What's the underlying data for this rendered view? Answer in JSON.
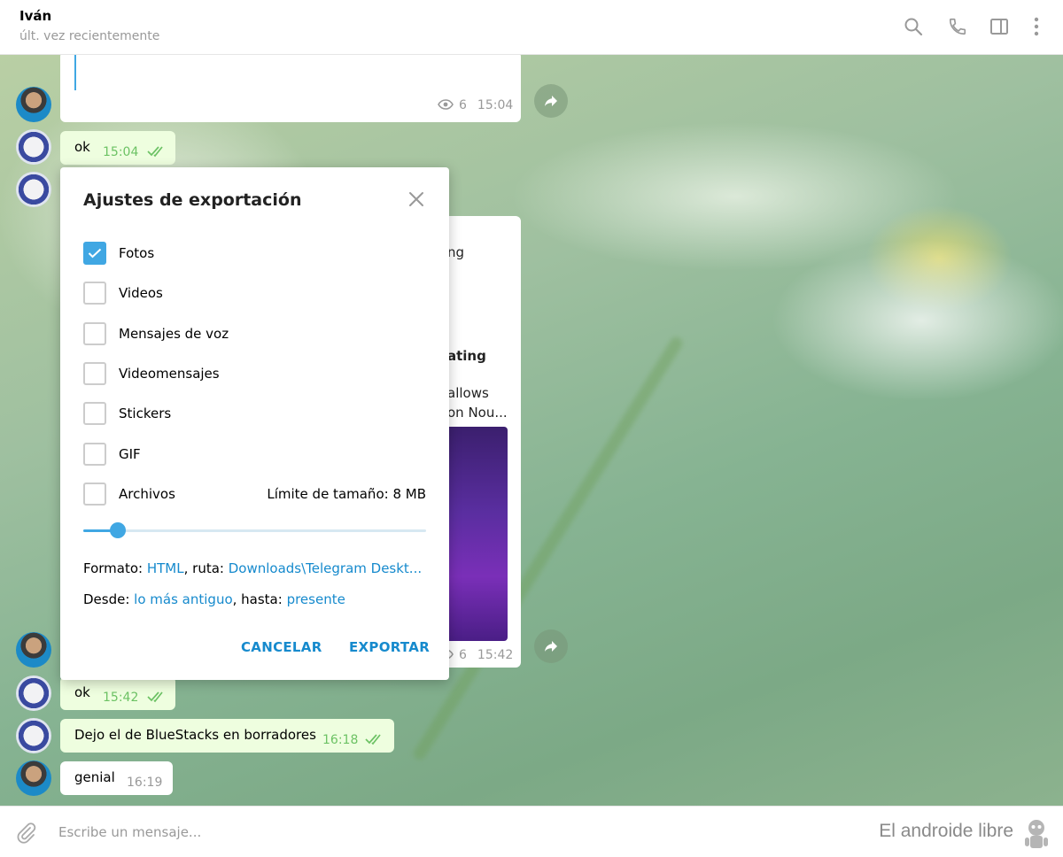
{
  "header": {
    "name": "Iván",
    "status": "últ. vez recientemente"
  },
  "messages": {
    "m1": {
      "views": "6",
      "time": "15:04"
    },
    "m2": {
      "text": "ok",
      "time": "15:04"
    },
    "m3_partial": {
      "line1": "ng",
      "line2": "ating",
      "line3": "allows",
      "line4": "on Nou..."
    },
    "m3": {
      "views": "6",
      "time": "15:42"
    },
    "m4": {
      "text": "ok",
      "time": "15:42"
    },
    "m5": {
      "text": "Dejo el de BlueStacks en borradores",
      "time": "16:18"
    },
    "m6": {
      "text": "genial",
      "time": "16:19"
    }
  },
  "dialog": {
    "title": "Ajustes de exportación",
    "options": [
      {
        "label": "Fotos",
        "checked": true
      },
      {
        "label": "Videos",
        "checked": false
      },
      {
        "label": "Mensajes de voz",
        "checked": false
      },
      {
        "label": "Videomensajes",
        "checked": false
      },
      {
        "label": "Stickers",
        "checked": false
      },
      {
        "label": "GIF",
        "checked": false
      },
      {
        "label": "Archivos",
        "checked": false
      }
    ],
    "size_limit": "Límite de tamaño: 8 MB",
    "slider_fraction": 0.1,
    "format_label": "Formato: ",
    "format_value": "HTML",
    "path_label": ", ruta: ",
    "path_value": "Downloads\\Telegram Deskt...",
    "from_label": "Desde: ",
    "from_value": "lo más antiguo",
    "to_label": ", hasta: ",
    "to_value": "presente",
    "cancel": "CANCELAR",
    "export": "EXPORTAR"
  },
  "composer": {
    "placeholder": "Escribe un mensaje...",
    "watermark": "El androide libre"
  },
  "colors": {
    "accent": "#40a7e3",
    "link": "#168acd",
    "out_bubble": "#eefedf",
    "out_time": "#6cc264"
  },
  "icons": [
    "search-icon",
    "phone-icon",
    "sidebar-icon",
    "more-icon",
    "close-icon",
    "check-icon",
    "forward-icon",
    "eye-icon",
    "double-check-icon",
    "paperclip-icon",
    "robot-icon"
  ]
}
